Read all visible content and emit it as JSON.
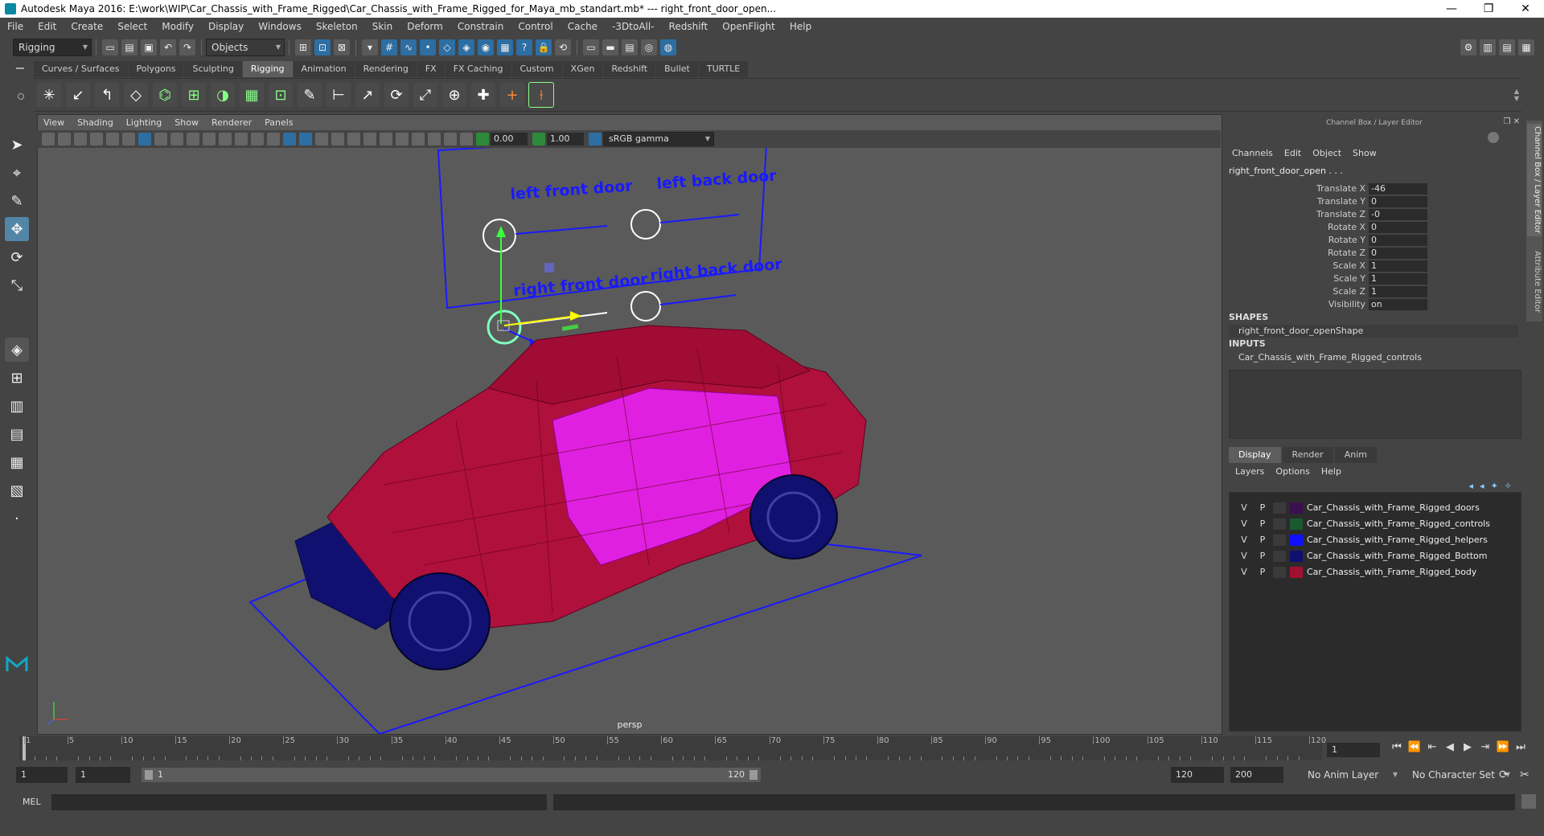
{
  "window": {
    "title": "Autodesk Maya 2016: E:\\work\\WIP\\Car_Chassis_with_Frame_Rigged\\Car_Chassis_with_Frame_Rigged_for_Maya_mb_standart.mb*   ---   right_front_door_open...",
    "minimize": "—",
    "maximize": "❐",
    "close": "✕"
  },
  "menubar": [
    "File",
    "Edit",
    "Create",
    "Select",
    "Modify",
    "Display",
    "Windows",
    "Skeleton",
    "Skin",
    "Deform",
    "Constrain",
    "Control",
    "Cache",
    "-3DtoAll-",
    "Redshift",
    "OpenFlight",
    "Help"
  ],
  "status_line": {
    "mode": "Rigging",
    "selection_mode": "Objects"
  },
  "shelf_tabs": [
    "Curves / Surfaces",
    "Polygons",
    "Sculpting",
    "Rigging",
    "Animation",
    "Rendering",
    "FX",
    "FX Caching",
    "Custom",
    "XGen",
    "Redshift",
    "Bullet",
    "TURTLE"
  ],
  "shelf_active": "Rigging",
  "viewport": {
    "menu": [
      "View",
      "Shading",
      "Lighting",
      "Show",
      "Renderer",
      "Panels"
    ],
    "near_value": "0.00",
    "far_value": "1.00",
    "color_space": "sRGB gamma",
    "camera": "persp",
    "labels": {
      "left_front": "left front door",
      "left_back": "left back door",
      "right_front": "right front door",
      "right_back": "right back door"
    }
  },
  "channel_box": {
    "title": "Channel Box / Layer Editor",
    "menu": [
      "Channels",
      "Edit",
      "Object",
      "Show"
    ],
    "object_name": "right_front_door_open . . .",
    "attributes": [
      {
        "label": "Translate X",
        "value": "-46"
      },
      {
        "label": "Translate Y",
        "value": "0"
      },
      {
        "label": "Translate Z",
        "value": "-0"
      },
      {
        "label": "Rotate X",
        "value": "0"
      },
      {
        "label": "Rotate Y",
        "value": "0"
      },
      {
        "label": "Rotate Z",
        "value": "0"
      },
      {
        "label": "Scale X",
        "value": "1"
      },
      {
        "label": "Scale Y",
        "value": "1"
      },
      {
        "label": "Scale Z",
        "value": "1"
      },
      {
        "label": "Visibility",
        "value": "on"
      }
    ],
    "shapes_header": "SHAPES",
    "shape_name": "right_front_door_openShape",
    "inputs_header": "INPUTS",
    "input_name": "Car_Chassis_with_Frame_Rigged_controls"
  },
  "layer_editor": {
    "tabs": [
      "Display",
      "Render",
      "Anim"
    ],
    "active_tab": "Display",
    "menu": [
      "Layers",
      "Options",
      "Help"
    ],
    "layers": [
      {
        "v": "V",
        "p": "P",
        "name": "Car_Chassis_with_Frame_Rigged_doors",
        "color": "#3a1050"
      },
      {
        "v": "V",
        "p": "P",
        "name": "Car_Chassis_with_Frame_Rigged_controls",
        "color": "#1a5a30"
      },
      {
        "v": "V",
        "p": "P",
        "name": "Car_Chassis_with_Frame_Rigged_helpers",
        "color": "#1010ff"
      },
      {
        "v": "V",
        "p": "P",
        "name": "Car_Chassis_with_Frame_Rigged_Bottom",
        "color": "#101070"
      },
      {
        "v": "V",
        "p": "P",
        "name": "Car_Chassis_with_Frame_Rigged_body",
        "color": "#a01030"
      }
    ]
  },
  "side_tabs": [
    "Channel Box / Layer Editor",
    "Attribute Editor"
  ],
  "time_slider": {
    "ticks": [
      "1",
      "5",
      "10",
      "15",
      "20",
      "25",
      "30",
      "35",
      "40",
      "45",
      "50",
      "55",
      "60",
      "65",
      "70",
      "75",
      "80",
      "85",
      "90",
      "95",
      "100",
      "105",
      "110",
      "115",
      "120"
    ],
    "current_frame": "1",
    "playback": [
      "⏮",
      "⏪",
      "⇤",
      "◀",
      "▶",
      "⇥",
      "⏩",
      "⏭"
    ]
  },
  "range": {
    "start": "1",
    "playback_start": "1",
    "slider_start": "1",
    "slider_end": "120",
    "playback_end": "120",
    "end": "200",
    "anim_layer": "No Anim Layer",
    "character_set": "No Character Set"
  },
  "command_line": {
    "label": "MEL"
  },
  "colors": {
    "background": "#444444",
    "viewport": "#5a5a5a",
    "wire_body": "#b0103c",
    "wire_doors": "#e020e0",
    "wire_bottom": "#101070",
    "controls": "#1010ff",
    "accent": "#5285a6"
  }
}
